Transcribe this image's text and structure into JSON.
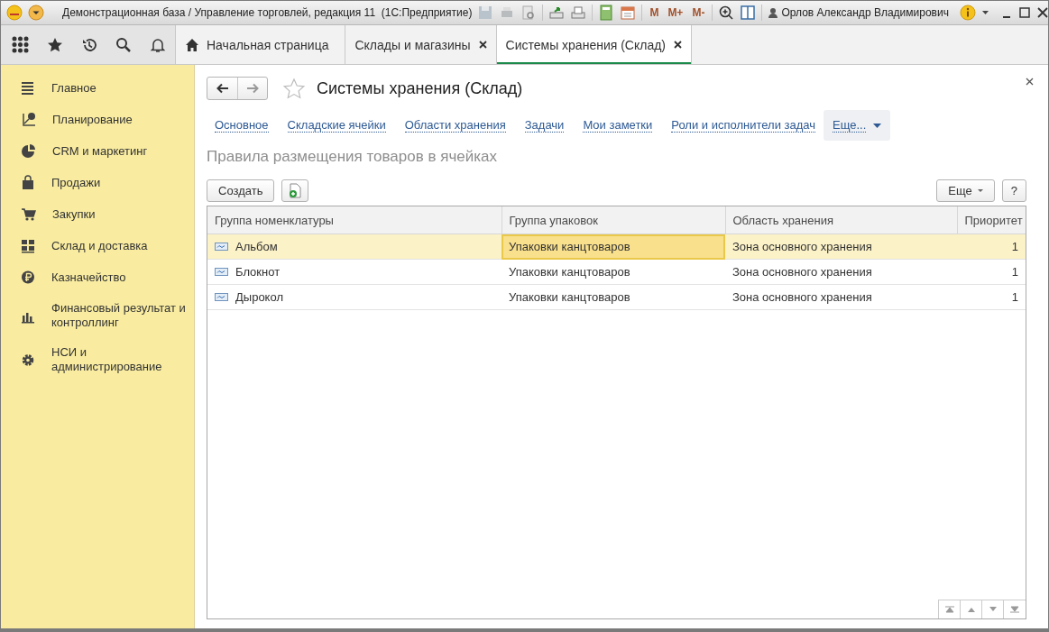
{
  "window": {
    "title": "Демонстрационная база / Управление торговлей, редакция 11  (1С:Предприятие)",
    "memory_buttons": [
      "M",
      "M+",
      "M-"
    ],
    "user": "Орлов Александр Владимирович"
  },
  "tabs": [
    {
      "label": "Начальная страница",
      "kind": "home",
      "selected": false
    },
    {
      "label": "Склады и магазины",
      "kind": "closable",
      "selected": false
    },
    {
      "label": "Системы хранения (Склад)",
      "kind": "closable",
      "selected": true
    }
  ],
  "sidebar": {
    "items": [
      {
        "label": "Главное",
        "kind": "list"
      },
      {
        "label": "Планирование",
        "kind": "plan"
      },
      {
        "label": "CRM и маркетинг",
        "kind": "pie"
      },
      {
        "label": "Продажи",
        "kind": "bag"
      },
      {
        "label": "Закупки",
        "kind": "cart"
      },
      {
        "label": "Склад и доставка",
        "kind": "grid"
      },
      {
        "label": "Казначейство",
        "kind": "ruble"
      },
      {
        "label": "Финансовый результат и контроллинг",
        "kind": "bars"
      },
      {
        "label": "НСИ и администрирование",
        "kind": "gear"
      }
    ]
  },
  "form": {
    "title": "Системы хранения (Склад)",
    "links": [
      "Основное",
      "Складские ячейки",
      "Области хранения",
      "Задачи",
      "Мои заметки",
      "Роли и исполнители задач"
    ],
    "more_link": "Еще...",
    "section_title": "Правила размещения товаров в ячейках",
    "create_button": "Создать",
    "more_button": "Еще",
    "help_button": "?",
    "table": {
      "columns": [
        "Группа номенклатуры",
        "Группа упаковок",
        "Область хранения",
        "Приоритет"
      ],
      "rows": [
        {
          "selected": true,
          "cells": [
            {
              "text": "Альбом",
              "focused": false
            },
            {
              "text": "Упаковки канцтоваров",
              "focused": true
            },
            {
              "text": "Зона основного хранения",
              "focused": false
            },
            {
              "text": "1",
              "focused": false
            }
          ]
        },
        {
          "selected": false,
          "cells": [
            {
              "text": "Блокнот",
              "focused": false
            },
            {
              "text": "Упаковки канцтоваров",
              "focused": false
            },
            {
              "text": "Зона основного хранения",
              "focused": false
            },
            {
              "text": "1",
              "focused": false
            }
          ]
        },
        {
          "selected": false,
          "cells": [
            {
              "text": "Дырокол",
              "focused": false
            },
            {
              "text": "Упаковки канцтоваров",
              "focused": false
            },
            {
              "text": "Зона основного хранения",
              "focused": false
            },
            {
              "text": "1",
              "focused": false
            }
          ]
        }
      ]
    }
  }
}
